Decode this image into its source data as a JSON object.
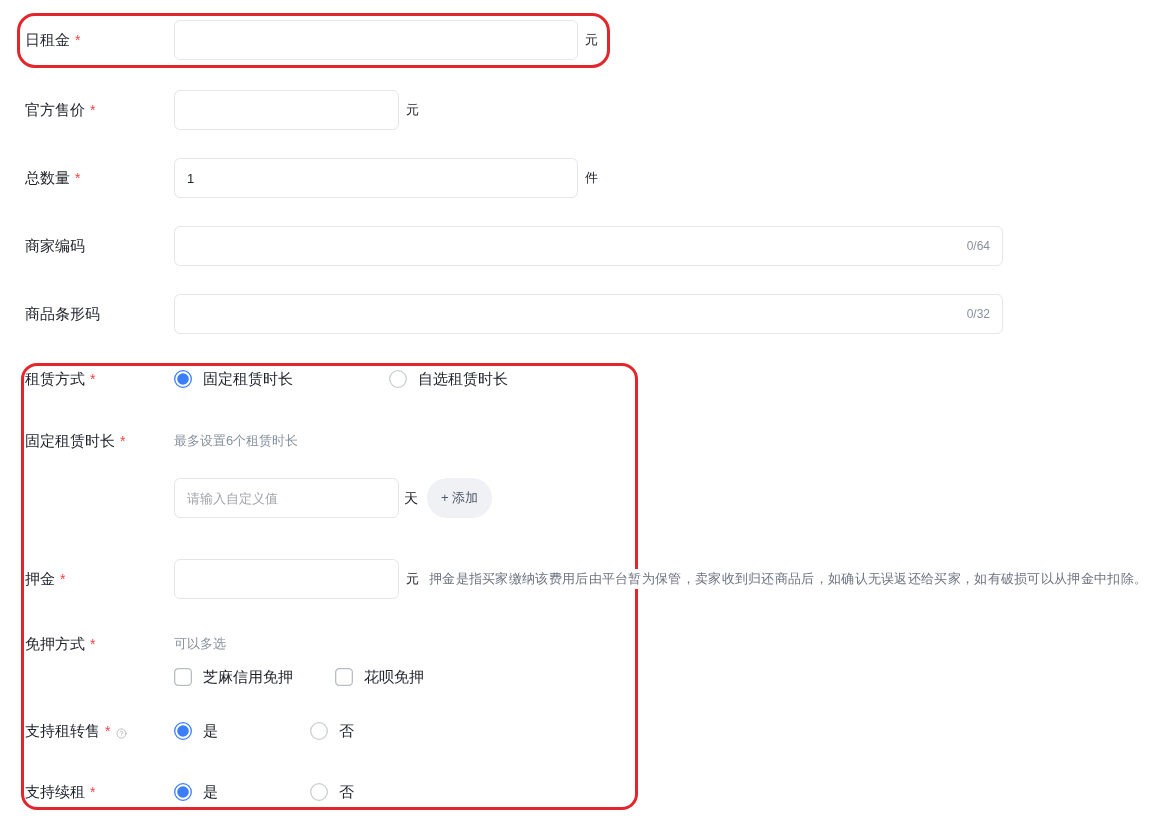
{
  "sections": [
    {
      "highlighted": true,
      "fields": [
        {
          "kind": "input",
          "label": "日租金",
          "required_mark": "*",
          "suffix": "元"
        }
      ]
    },
    {
      "fields": [
        {
          "kind": "input",
          "label": "官方售价",
          "required_mark": "*",
          "suffix": "元"
        },
        {
          "kind": "input",
          "label": "总数量",
          "required_mark": "*",
          "value": "1",
          "suffix": "件"
        },
        {
          "kind": "input",
          "label": "商家编码",
          "counter": "0/64"
        },
        {
          "kind": "input",
          "label": "商品条形码",
          "counter": "0/32"
        }
      ]
    },
    {
      "highlighted": true,
      "fields": [
        {
          "kind": "radio",
          "label": "租赁方式",
          "required_mark": "*",
          "options": [
            {
              "label": "固定租赁时长",
              "selected": true
            },
            {
              "label": "自选租赁时长",
              "selected": false
            }
          ]
        },
        {
          "kind": "duration",
          "label": "固定租赁时长",
          "required_mark": "*",
          "hint": "最多设置6个租赁时长",
          "placeholder": "请输入自定义值",
          "suffix": "天",
          "add_button": "+ 添加"
        },
        {
          "kind": "input",
          "label": "押金",
          "required_mark": "*",
          "suffix": "元",
          "note": "押金是指买家缴纳该费用后由平台暂为保管，卖家收到归还商品后，如确认无误返还给买家，如有破损可以从押金中扣除。"
        },
        {
          "kind": "checkbox",
          "label": "免押方式",
          "required_mark": "*",
          "hint": "可以多选",
          "options": [
            {
              "label": "芝麻信用免押",
              "checked": false
            },
            {
              "label": "花呗免押",
              "checked": false
            }
          ]
        },
        {
          "kind": "radio",
          "label": "支持租转售",
          "required_mark": "*",
          "help": true,
          "options": [
            {
              "label": "是",
              "selected": true
            },
            {
              "label": "否",
              "selected": false
            }
          ]
        },
        {
          "kind": "radio",
          "label": "支持续租",
          "required_mark": "*",
          "options": [
            {
              "label": "是",
              "selected": true
            },
            {
              "label": "否",
              "selected": false
            }
          ]
        }
      ]
    }
  ]
}
